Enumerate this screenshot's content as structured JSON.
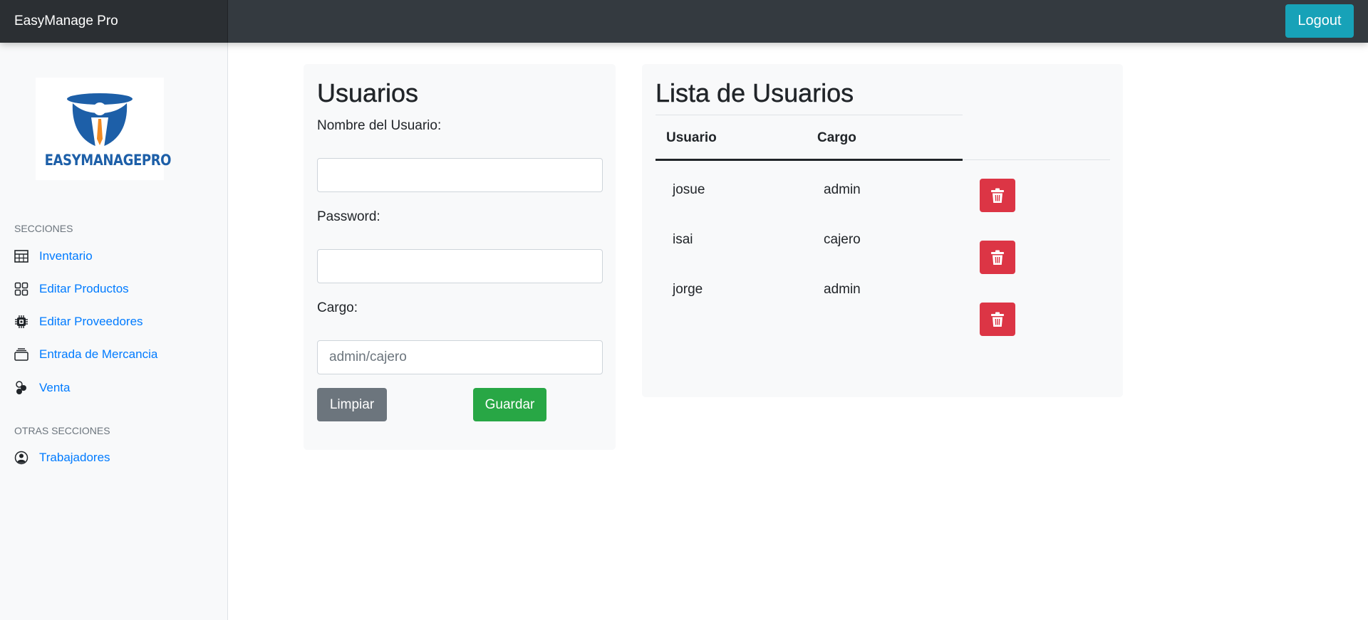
{
  "navbar": {
    "brand": "EasyManage Pro",
    "logout_label": "Logout"
  },
  "sidebar": {
    "logo_text": "EASYMANAGEPRO",
    "section1": "SECCIONES",
    "items": [
      {
        "label": "Inventario",
        "icon": "table-icon"
      },
      {
        "label": "Editar Productos",
        "icon": "grid-icon"
      },
      {
        "label": "Editar Proveedores",
        "icon": "cpu-icon"
      },
      {
        "label": "Entrada de Mercancia",
        "icon": "stack-icon"
      },
      {
        "label": "Venta",
        "icon": "toggles-icon"
      }
    ],
    "section2": "OTRAS SECCIONES",
    "other_items": [
      {
        "label": "Trabajadores",
        "icon": "person-circle-icon"
      }
    ]
  },
  "form": {
    "title": "Usuarios",
    "name_label": "Nombre del Usuario:",
    "name_value": "",
    "password_label": "Password:",
    "password_value": "",
    "role_label": "Cargo:",
    "role_placeholder": "admin/cajero",
    "clear_label": "Limpiar",
    "save_label": "Guardar"
  },
  "list": {
    "title": "Lista de Usuarios",
    "columns": [
      "Usuario",
      "Cargo"
    ],
    "rows": [
      {
        "user": "josue",
        "role": "admin"
      },
      {
        "user": "isai",
        "role": "cajero"
      },
      {
        "user": "jorge",
        "role": "admin"
      }
    ],
    "delete_icon": "trash-icon"
  },
  "colors": {
    "navbar": "#343a40",
    "brand_bg": "#2b2f33",
    "logout": "#17a2b8",
    "link": "#007bff",
    "clear": "#6c757d",
    "save": "#28a745",
    "delete": "#dc3545"
  }
}
